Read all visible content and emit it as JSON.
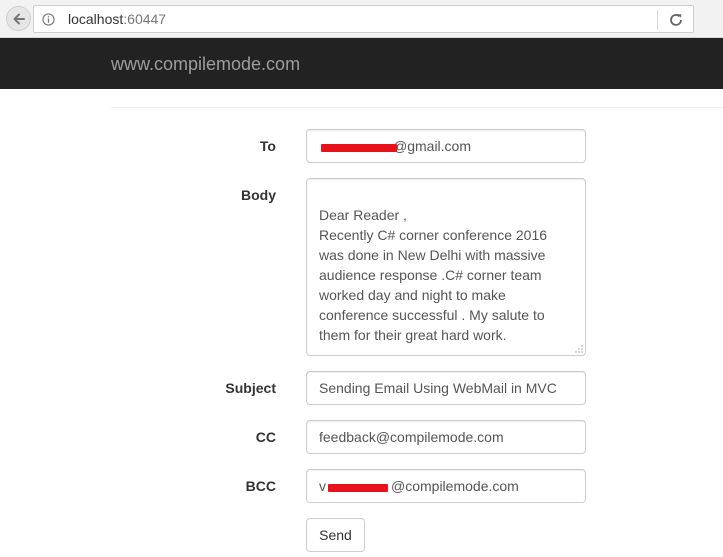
{
  "browser": {
    "url_host": "localhost",
    "url_port": ":60447"
  },
  "navbar": {
    "brand": "www.compilemode.com"
  },
  "form": {
    "to": {
      "label": "To",
      "value": "@gmail.com"
    },
    "body": {
      "label": "Body",
      "value": "Dear Reader ,\nRecently C# corner conference 2016 was done in New Delhi with massive audience response .C# corner team worked day and night to make conference successful . My salute to them for their great hard work."
    },
    "subject": {
      "label": "Subject",
      "value": "Sending Email Using WebMail in MVC"
    },
    "cc": {
      "label": "CC",
      "value": "feedback@compilemode.com"
    },
    "bcc": {
      "label": "BCC",
      "value_prefix": "v",
      "value": "@compilemode.com"
    },
    "send_label": "Send"
  },
  "colors": {
    "navbar_bg": "#222222",
    "brand_text": "#9d9d9d",
    "redaction": "#e8101a"
  },
  "icons": {
    "back": "back-arrow-icon",
    "info": "info-icon",
    "reload": "reload-icon"
  }
}
